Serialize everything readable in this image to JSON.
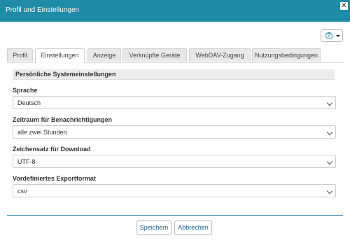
{
  "window": {
    "title": "Profil und Einstellungen",
    "close_symbol": "×"
  },
  "help_menu": {
    "icon": "help-circle-icon",
    "symbol": "?"
  },
  "tabs": [
    {
      "label": "Profil",
      "active": false
    },
    {
      "label": "Einstellungen",
      "active": true
    },
    {
      "label": "Anzeige",
      "active": false
    },
    {
      "label": "Verknüpfte Geräte",
      "active": false
    },
    {
      "label": "WebDAV-Zugang",
      "active": false
    },
    {
      "label": "Nutzungsbedingungen",
      "active": false
    }
  ],
  "section": {
    "title": "Persönliche Systemeinstellungen"
  },
  "fields": [
    {
      "label": "Sprache",
      "value": "Deutsch"
    },
    {
      "label": "Zeitraum für Benachrichtigungen",
      "value": "alle zwei Stunden"
    },
    {
      "label": "Zeichensatz für Download",
      "value": "UTF-8"
    },
    {
      "label": "Vordefiniertes Exportformat",
      "value": "csv"
    }
  ],
  "buttons": {
    "save": "Speichern",
    "cancel": "Abbrechen"
  },
  "colors": {
    "accent": "#1f8ba6",
    "button_text": "#1a5f88"
  }
}
